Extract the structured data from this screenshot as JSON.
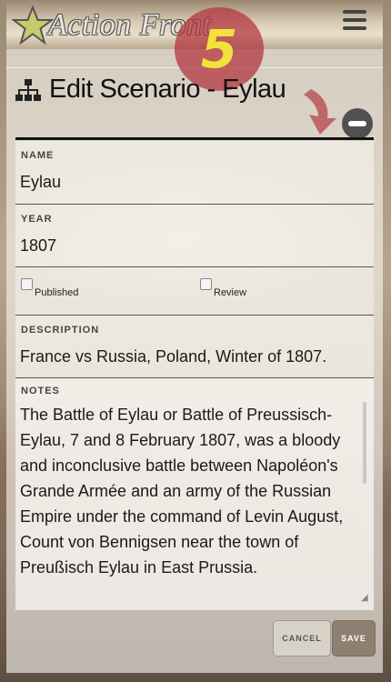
{
  "header": {
    "logo_text": "Action Front",
    "step_badge": "5"
  },
  "page": {
    "title": "Edit Scenario - Eylau"
  },
  "form": {
    "name_label": "NAME",
    "name_value": "Eylau",
    "year_label": "YEAR",
    "year_value": "1807",
    "published_label": "Published",
    "review_label": "Review",
    "description_label": "DESCRIPTION",
    "description_value": "France vs Russia, Poland, Winter of 1807.",
    "notes_label": "NOTES",
    "notes_value": "The Battle of Eylau or Battle of Preussisch-Eylau, 7 and 8 February 1807, was a bloody and inconclusive battle between Napoléon's Grande Armée and an army of the Russian Empire under the command of Levin August, Count von Bennigsen near the town of Preußisch Eylau in East Prussia."
  },
  "buttons": {
    "cancel": "CANCEL",
    "save": "SAVE"
  },
  "icons": {
    "logo": "star-icon",
    "menu": "hamburger-menu-icon",
    "title": "sitemap-icon",
    "remove": "minus-circle-icon",
    "annotation": "curved-arrow-icon"
  },
  "colors": {
    "badge": "#b2323c",
    "badge_text": "#f2e23a",
    "save_button": "#8d8070"
  }
}
